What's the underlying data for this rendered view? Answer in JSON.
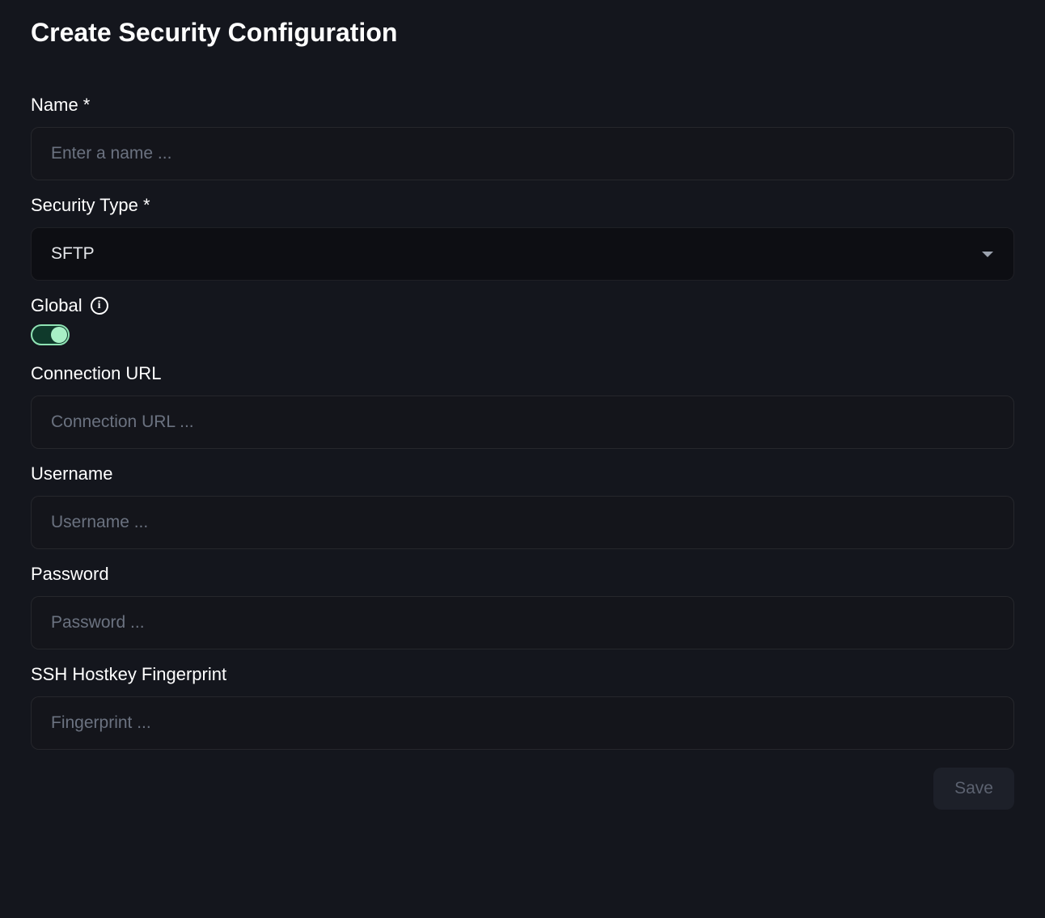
{
  "page": {
    "title": "Create Security Configuration"
  },
  "form": {
    "name": {
      "label": "Name *",
      "placeholder": "Enter a name ...",
      "value": ""
    },
    "securityType": {
      "label": "Security Type *",
      "selected": "SFTP"
    },
    "global": {
      "label": "Global",
      "enabled": true
    },
    "connectionUrl": {
      "label": "Connection URL",
      "placeholder": "Connection URL ...",
      "value": ""
    },
    "username": {
      "label": "Username",
      "placeholder": "Username ...",
      "value": ""
    },
    "password": {
      "label": "Password",
      "placeholder": "Password ...",
      "value": ""
    },
    "sshFingerprint": {
      "label": "SSH Hostkey Fingerprint",
      "placeholder": "Fingerprint ...",
      "value": ""
    }
  },
  "actions": {
    "save": "Save"
  }
}
